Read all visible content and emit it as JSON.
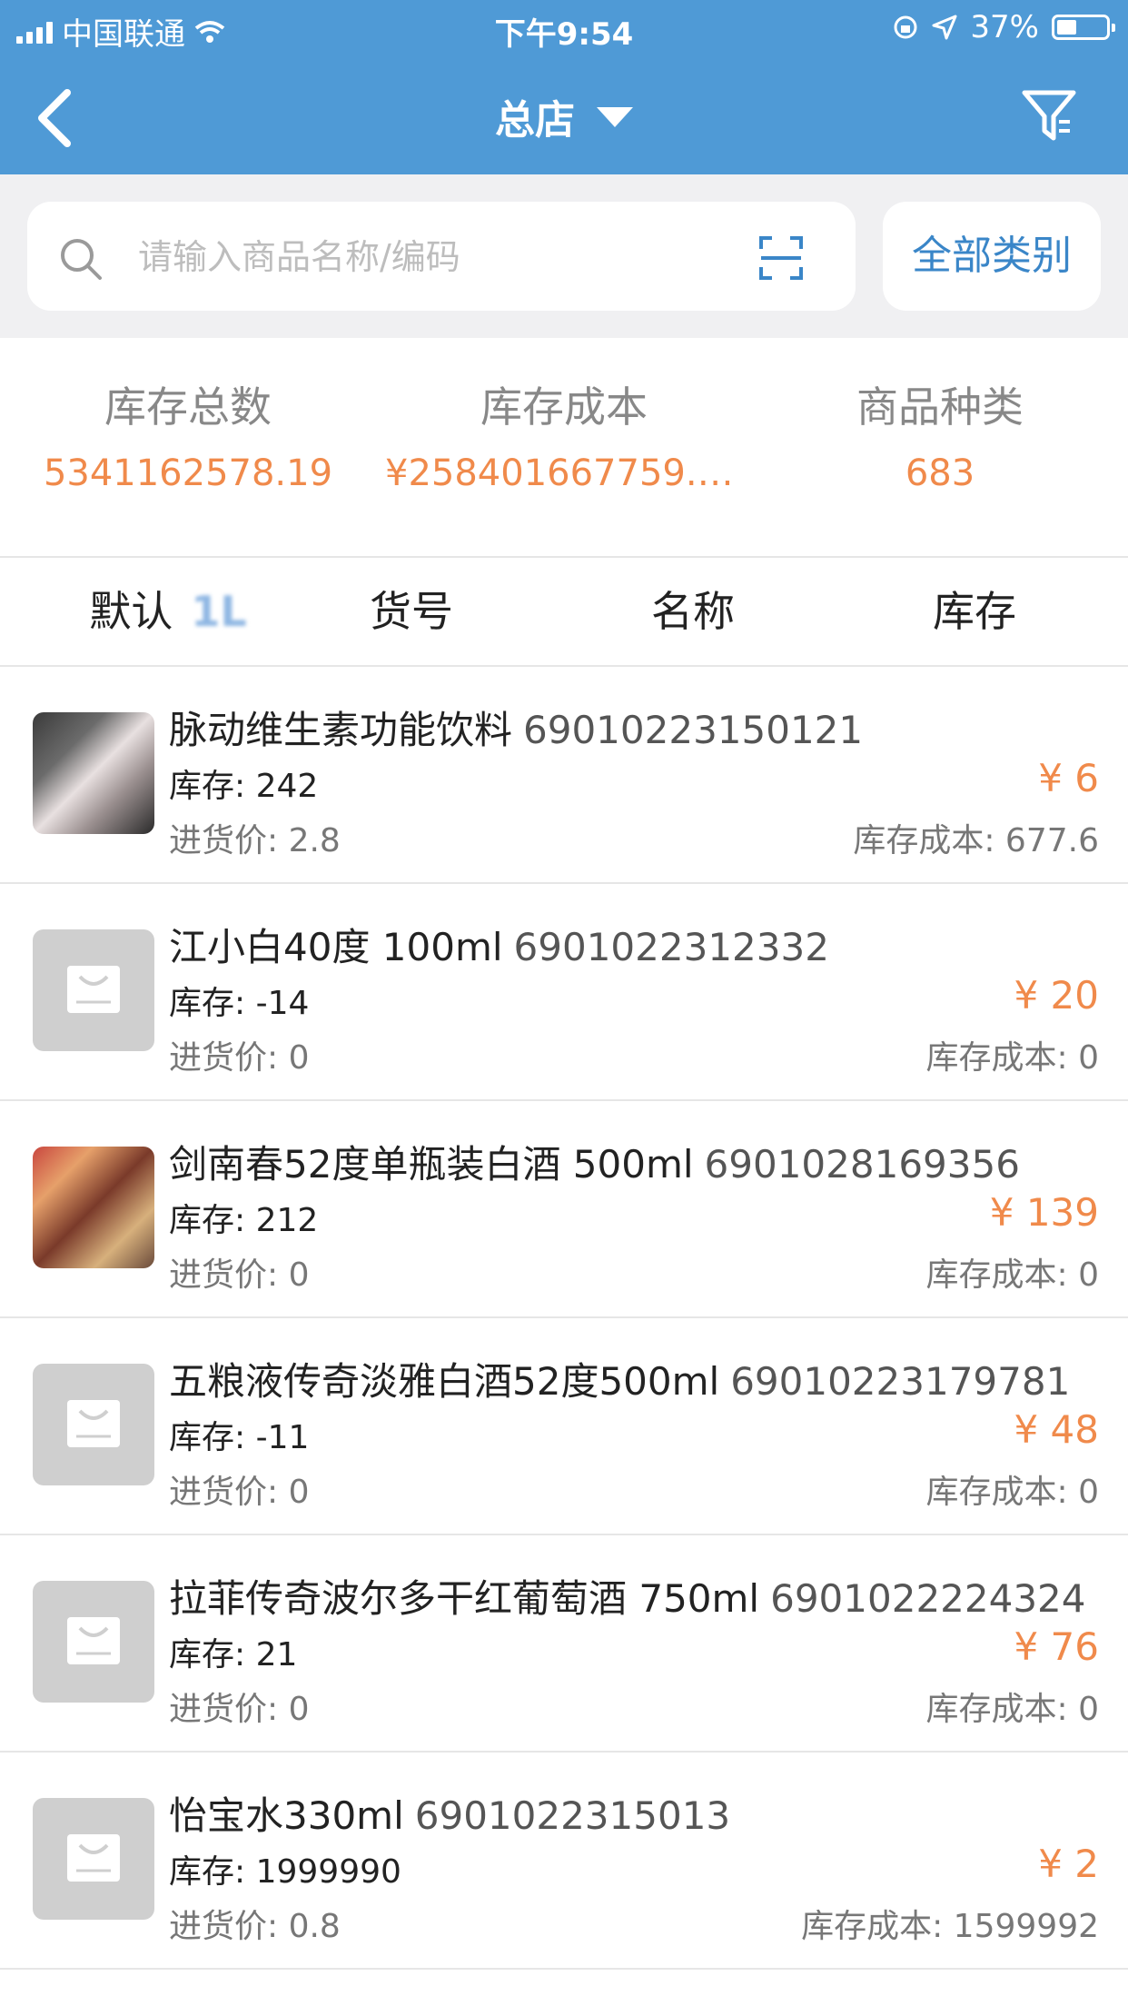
{
  "status_bar": {
    "carrier": "中国联通",
    "time": "下午9:54",
    "battery": "37%"
  },
  "nav": {
    "title": "总店"
  },
  "search": {
    "placeholder": "请输入商品名称/编码",
    "category_button": "全部类别"
  },
  "stats": [
    {
      "label": "库存总数",
      "value": "5341162578.19"
    },
    {
      "label": "库存成本",
      "value": "¥258401667759.2..."
    },
    {
      "label": "商品种类",
      "value": "683"
    }
  ],
  "sort_tabs": [
    "默认",
    "货号",
    "名称",
    "库存"
  ],
  "sort_extra": "1L",
  "products": [
    {
      "name": "脉动维生素功能饮料",
      "code": "69010223150121",
      "stock": "库存: 242",
      "purchase_price": "进货价: 2.8",
      "price": "¥ 6",
      "stock_cost": "库存成本: 677.6",
      "thumb": "photo"
    },
    {
      "name": "江小白40度 100ml",
      "code": "6901022312332",
      "stock": "库存: -14",
      "purchase_price": "进货价: 0",
      "price": "¥ 20",
      "stock_cost": "库存成本: 0",
      "thumb": "placeholder"
    },
    {
      "name": "剑南春52度单瓶装白酒 500ml",
      "code": "6901028169356",
      "stock": "库存: 212",
      "purchase_price": "进货价: 0",
      "price": "¥ 139",
      "stock_cost": "库存成本: 0",
      "thumb": "photo"
    },
    {
      "name": "五粮液传奇淡雅白酒52度500ml",
      "code": "69010223179781",
      "stock": "库存: -11",
      "purchase_price": "进货价: 0",
      "price": "¥ 48",
      "stock_cost": "库存成本: 0",
      "thumb": "placeholder"
    },
    {
      "name": "拉菲传奇波尔多干红葡萄酒 750ml",
      "code": "6901022224324",
      "stock": "库存: 21",
      "purchase_price": "进货价: 0",
      "price": "¥ 76",
      "stock_cost": "库存成本: 0",
      "thumb": "placeholder"
    },
    {
      "name": "怡宝水330ml",
      "code": "6901022315013",
      "stock": "库存: 1999990",
      "purchase_price": "进货价: 0.8",
      "price": "¥ 2",
      "stock_cost": "库存成本: 1599992",
      "thumb": "placeholder"
    }
  ],
  "colors": {
    "header": "#4f9ad6",
    "accent_orange": "#f08a4b",
    "link_blue": "#3a86c8"
  }
}
